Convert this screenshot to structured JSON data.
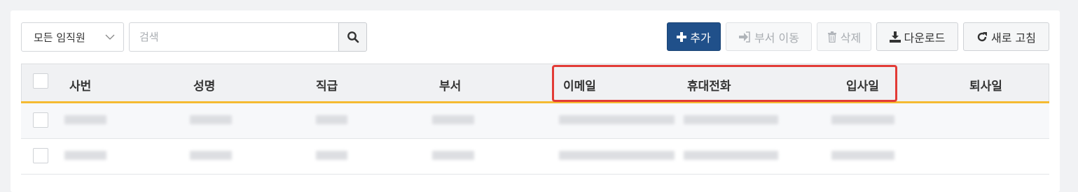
{
  "toolbar": {
    "filter_select": "모든 임직원",
    "search_placeholder": "검색",
    "add_label": "추가",
    "move_dept_label": "부서 이동",
    "delete_label": "삭제",
    "download_label": "다운로드",
    "refresh_label": "새로 고침"
  },
  "table": {
    "columns": [
      "사번",
      "성명",
      "직급",
      "부서",
      "이메일",
      "휴대전화",
      "입사일",
      "퇴사일"
    ]
  },
  "colors": {
    "primary": "#20508a",
    "header_accent": "#f5bb32",
    "highlight_box": "#e23b36"
  }
}
